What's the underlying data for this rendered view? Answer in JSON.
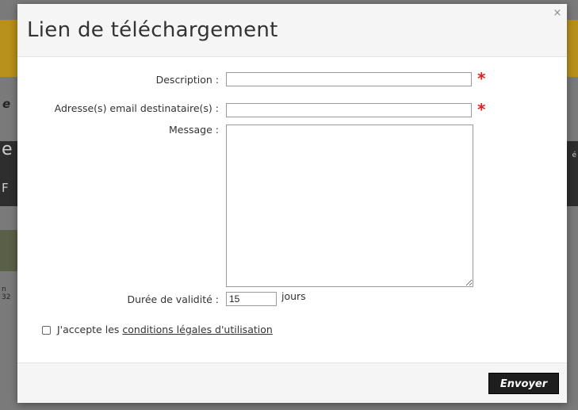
{
  "modal": {
    "title": "Lien de téléchargement",
    "close_symbol": "×"
  },
  "form": {
    "description": {
      "label": "Description :",
      "value": ""
    },
    "email": {
      "label": "Adresse(s) email destinataire(s) :",
      "value": ""
    },
    "message": {
      "label": "Message :",
      "value": ""
    },
    "duree": {
      "label": "Durée de validité :",
      "value": "15",
      "unit": "jours"
    },
    "required_marker": "*"
  },
  "accept": {
    "prefix": "J'accepte les ",
    "link_label": "conditions légales d'utilisation",
    "checked": false
  },
  "footer": {
    "send_label": "Envoyer"
  },
  "background": {
    "letter_e1": "e",
    "letter_e2": "e",
    "letter_f": "F",
    "small_text": "n\n32",
    "right_text": "é"
  },
  "colors": {
    "required": "#e02020",
    "button_bg": "#1e1e1e",
    "header_bg": "#f5f5f5",
    "overlay_band": "#b8901a"
  }
}
